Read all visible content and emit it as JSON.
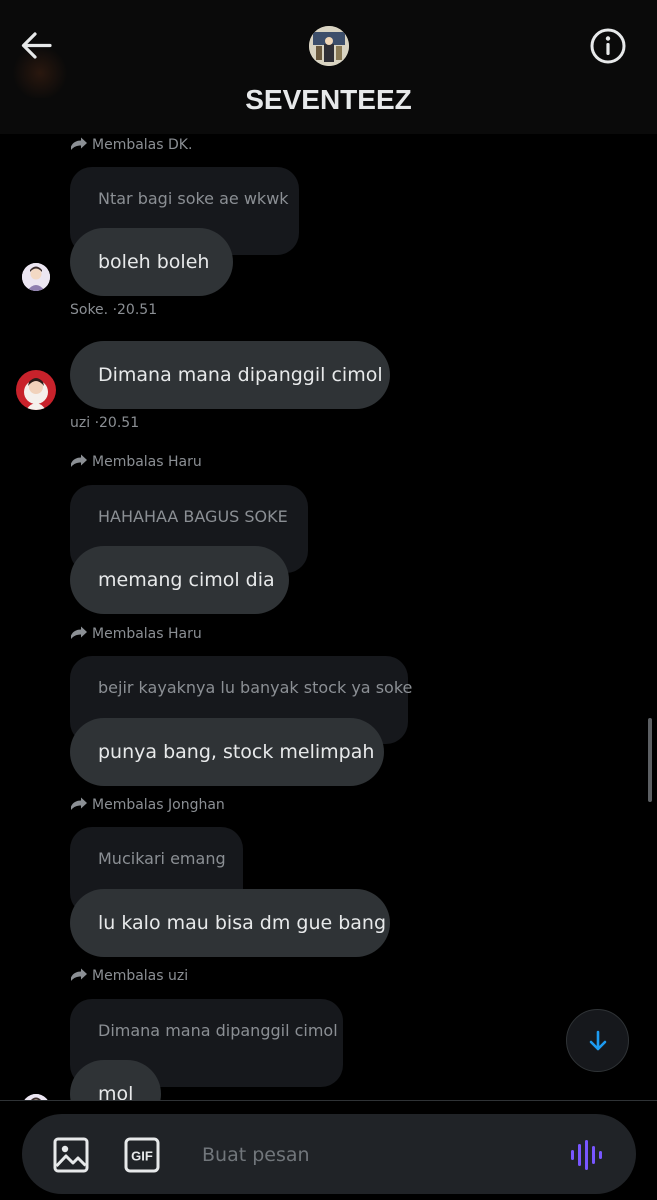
{
  "header": {
    "title": "SEVENTEEZ",
    "back_icon": "arrow-left-icon",
    "info_icon": "info-icon"
  },
  "colors": {
    "background": "#000000",
    "bubble": "#2f3336",
    "quoted_bubble": "#16181c",
    "muted_text": "#8b8f94",
    "accent": "#1d9bf0",
    "voice_accent": "#7856ff"
  },
  "messages": [
    {
      "reply_to": "Membalas DK.",
      "quoted": "Ntar bagi soke ae wkwk",
      "text": "boleh boleh",
      "sender": "Soke.",
      "time": "·20.51"
    },
    {
      "text": "Dimana mana dipanggil cimol",
      "sender": "uzi",
      "time": "·20.51"
    },
    {
      "reply_to": "Membalas Haru",
      "quoted": "HAHAHAA BAGUS SOKE",
      "text": "memang cimol dia"
    },
    {
      "reply_to": "Membalas Haru",
      "quoted": "bejir kayaknya lu banyak stock ya soke",
      "text": "punya bang, stock melimpah"
    },
    {
      "reply_to": "Membalas Jonghan",
      "quoted": "Mucikari emang",
      "text": "lu kalo mau bisa dm gue bang"
    },
    {
      "reply_to": "Membalas uzi",
      "quoted": "Dimana mana dipanggil cimol",
      "text": "mol"
    }
  ],
  "composer": {
    "placeholder": "Buat pesan",
    "value": "",
    "media_icon": "image-icon",
    "gif_label": "GIF",
    "voice_icon": "voice-waveform-icon"
  },
  "scroll_down_icon": "arrow-down-icon"
}
